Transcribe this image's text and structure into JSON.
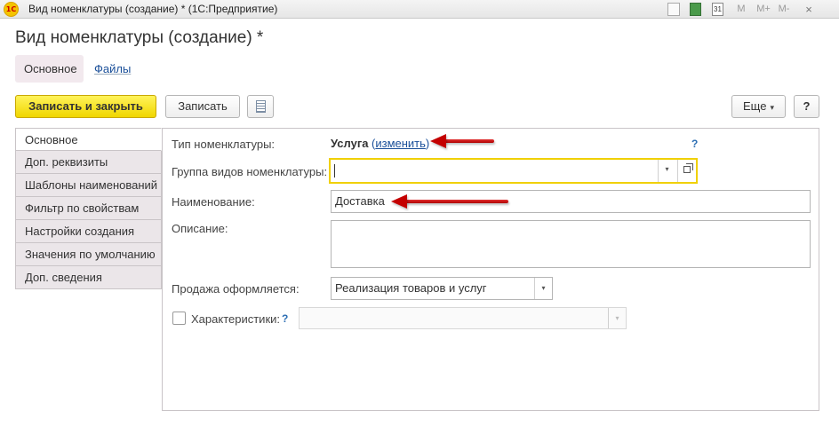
{
  "window": {
    "title": "Вид номенклатуры (создание) * (1С:Предприятие)",
    "logo_text": "1С",
    "toolbar_icons": {
      "doc": "document-icon",
      "calc": "calculator-icon",
      "calendar": "calendar-icon",
      "calendar_text": "31",
      "m": "M",
      "m_plus": "M+",
      "m_minus": "M-",
      "close": "×"
    }
  },
  "form": {
    "title": "Вид номенклатуры (создание) *",
    "nav_tabs": [
      {
        "label": "Основное",
        "active": true
      },
      {
        "label": "Файлы",
        "active": false
      }
    ]
  },
  "command_bar": {
    "save_close_label": "Записать и закрыть",
    "save_label": "Записать",
    "more_label": "Еще",
    "more_caret": "▾",
    "help_label": "?"
  },
  "pages": [
    {
      "label": "Основное",
      "active": true
    },
    {
      "label": "Доп. реквизиты",
      "active": false
    },
    {
      "label": "Шаблоны наименований",
      "active": false
    },
    {
      "label": "Фильтр по свойствам",
      "active": false
    },
    {
      "label": "Настройки создания",
      "active": false
    },
    {
      "label": "Значения по умолчанию",
      "active": false
    },
    {
      "label": "Доп. сведения",
      "active": false
    }
  ],
  "fields": {
    "type": {
      "label": "Тип номенклатуры:",
      "value": "Услуга",
      "link_open": " (",
      "link": "изменить",
      "link_close": ")",
      "help": "?"
    },
    "group": {
      "label": "Группа видов номенклатуры:",
      "value": ""
    },
    "name": {
      "label": "Наименование:",
      "value": "Доставка"
    },
    "description": {
      "label": "Описание:",
      "value": ""
    },
    "sale": {
      "label": "Продажа оформляется:",
      "value": "Реализация товаров и услуг"
    },
    "characteristics": {
      "label": "Характеристики:",
      "help": "?",
      "checked": false,
      "value": ""
    }
  },
  "dropdown_caret": "▾",
  "colors": {
    "primary_button": "#f0d600",
    "focus_border": "#f0d000",
    "link": "#1a4f99",
    "annotation_arrow": "#c40000"
  }
}
